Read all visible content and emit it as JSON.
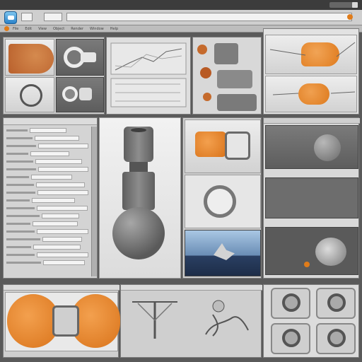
{
  "app": {
    "toolbar_field_text": "",
    "search_placeholder": "",
    "menu_items": [
      "File",
      "Edit",
      "View",
      "Object",
      "Render",
      "Window",
      "Help"
    ],
    "colors": {
      "accent": "#e07c1a",
      "chrome": "#3c3c3c",
      "panel": "#c9c9c9"
    }
  },
  "properties_panel": {
    "header": "",
    "rows": 18
  },
  "bottom_status": {
    "left": "",
    "right": ""
  },
  "icons": [
    "app-icon",
    "orange-dot-icon",
    "close-icon"
  ]
}
